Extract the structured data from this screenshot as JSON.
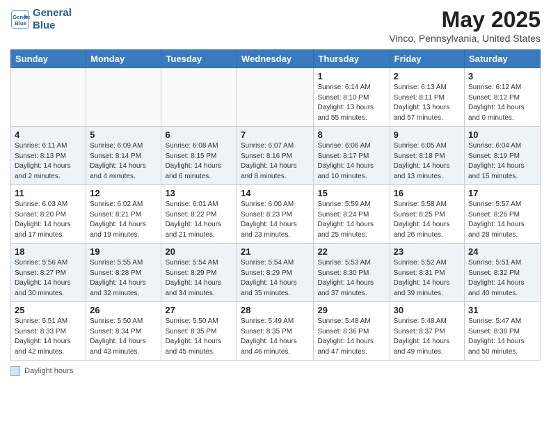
{
  "header": {
    "logo_line1": "General",
    "logo_line2": "Blue",
    "title": "May 2025",
    "subtitle": "Vinco, Pennsylvania, United States"
  },
  "footer": {
    "box_label": "Daylight hours"
  },
  "weekdays": [
    "Sunday",
    "Monday",
    "Tuesday",
    "Wednesday",
    "Thursday",
    "Friday",
    "Saturday"
  ],
  "weeks": [
    [
      {
        "day": "",
        "info": ""
      },
      {
        "day": "",
        "info": ""
      },
      {
        "day": "",
        "info": ""
      },
      {
        "day": "",
        "info": ""
      },
      {
        "day": "1",
        "info": "Sunrise: 6:14 AM\nSunset: 8:10 PM\nDaylight: 13 hours\nand 55 minutes."
      },
      {
        "day": "2",
        "info": "Sunrise: 6:13 AM\nSunset: 8:11 PM\nDaylight: 13 hours\nand 57 minutes."
      },
      {
        "day": "3",
        "info": "Sunrise: 6:12 AM\nSunset: 8:12 PM\nDaylight: 14 hours\nand 0 minutes."
      }
    ],
    [
      {
        "day": "4",
        "info": "Sunrise: 6:11 AM\nSunset: 8:13 PM\nDaylight: 14 hours\nand 2 minutes."
      },
      {
        "day": "5",
        "info": "Sunrise: 6:09 AM\nSunset: 8:14 PM\nDaylight: 14 hours\nand 4 minutes."
      },
      {
        "day": "6",
        "info": "Sunrise: 6:08 AM\nSunset: 8:15 PM\nDaylight: 14 hours\nand 6 minutes."
      },
      {
        "day": "7",
        "info": "Sunrise: 6:07 AM\nSunset: 8:16 PM\nDaylight: 14 hours\nand 8 minutes."
      },
      {
        "day": "8",
        "info": "Sunrise: 6:06 AM\nSunset: 8:17 PM\nDaylight: 14 hours\nand 10 minutes."
      },
      {
        "day": "9",
        "info": "Sunrise: 6:05 AM\nSunset: 8:18 PM\nDaylight: 14 hours\nand 13 minutes."
      },
      {
        "day": "10",
        "info": "Sunrise: 6:04 AM\nSunset: 8:19 PM\nDaylight: 14 hours\nand 15 minutes."
      }
    ],
    [
      {
        "day": "11",
        "info": "Sunrise: 6:03 AM\nSunset: 8:20 PM\nDaylight: 14 hours\nand 17 minutes."
      },
      {
        "day": "12",
        "info": "Sunrise: 6:02 AM\nSunset: 8:21 PM\nDaylight: 14 hours\nand 19 minutes."
      },
      {
        "day": "13",
        "info": "Sunrise: 6:01 AM\nSunset: 8:22 PM\nDaylight: 14 hours\nand 21 minutes."
      },
      {
        "day": "14",
        "info": "Sunrise: 6:00 AM\nSunset: 8:23 PM\nDaylight: 14 hours\nand 23 minutes."
      },
      {
        "day": "15",
        "info": "Sunrise: 5:59 AM\nSunset: 8:24 PM\nDaylight: 14 hours\nand 25 minutes."
      },
      {
        "day": "16",
        "info": "Sunrise: 5:58 AM\nSunset: 8:25 PM\nDaylight: 14 hours\nand 26 minutes."
      },
      {
        "day": "17",
        "info": "Sunrise: 5:57 AM\nSunset: 8:26 PM\nDaylight: 14 hours\nand 28 minutes."
      }
    ],
    [
      {
        "day": "18",
        "info": "Sunrise: 5:56 AM\nSunset: 8:27 PM\nDaylight: 14 hours\nand 30 minutes."
      },
      {
        "day": "19",
        "info": "Sunrise: 5:55 AM\nSunset: 8:28 PM\nDaylight: 14 hours\nand 32 minutes."
      },
      {
        "day": "20",
        "info": "Sunrise: 5:54 AM\nSunset: 8:29 PM\nDaylight: 14 hours\nand 34 minutes."
      },
      {
        "day": "21",
        "info": "Sunrise: 5:54 AM\nSunset: 8:29 PM\nDaylight: 14 hours\nand 35 minutes."
      },
      {
        "day": "22",
        "info": "Sunrise: 5:53 AM\nSunset: 8:30 PM\nDaylight: 14 hours\nand 37 minutes."
      },
      {
        "day": "23",
        "info": "Sunrise: 5:52 AM\nSunset: 8:31 PM\nDaylight: 14 hours\nand 39 minutes."
      },
      {
        "day": "24",
        "info": "Sunrise: 5:51 AM\nSunset: 8:32 PM\nDaylight: 14 hours\nand 40 minutes."
      }
    ],
    [
      {
        "day": "25",
        "info": "Sunrise: 5:51 AM\nSunset: 8:33 PM\nDaylight: 14 hours\nand 42 minutes."
      },
      {
        "day": "26",
        "info": "Sunrise: 5:50 AM\nSunset: 8:34 PM\nDaylight: 14 hours\nand 43 minutes."
      },
      {
        "day": "27",
        "info": "Sunrise: 5:50 AM\nSunset: 8:35 PM\nDaylight: 14 hours\nand 45 minutes."
      },
      {
        "day": "28",
        "info": "Sunrise: 5:49 AM\nSunset: 8:35 PM\nDaylight: 14 hours\nand 46 minutes."
      },
      {
        "day": "29",
        "info": "Sunrise: 5:48 AM\nSunset: 8:36 PM\nDaylight: 14 hours\nand 47 minutes."
      },
      {
        "day": "30",
        "info": "Sunrise: 5:48 AM\nSunset: 8:37 PM\nDaylight: 14 hours\nand 49 minutes."
      },
      {
        "day": "31",
        "info": "Sunrise: 5:47 AM\nSunset: 8:38 PM\nDaylight: 14 hours\nand 50 minutes."
      }
    ]
  ]
}
